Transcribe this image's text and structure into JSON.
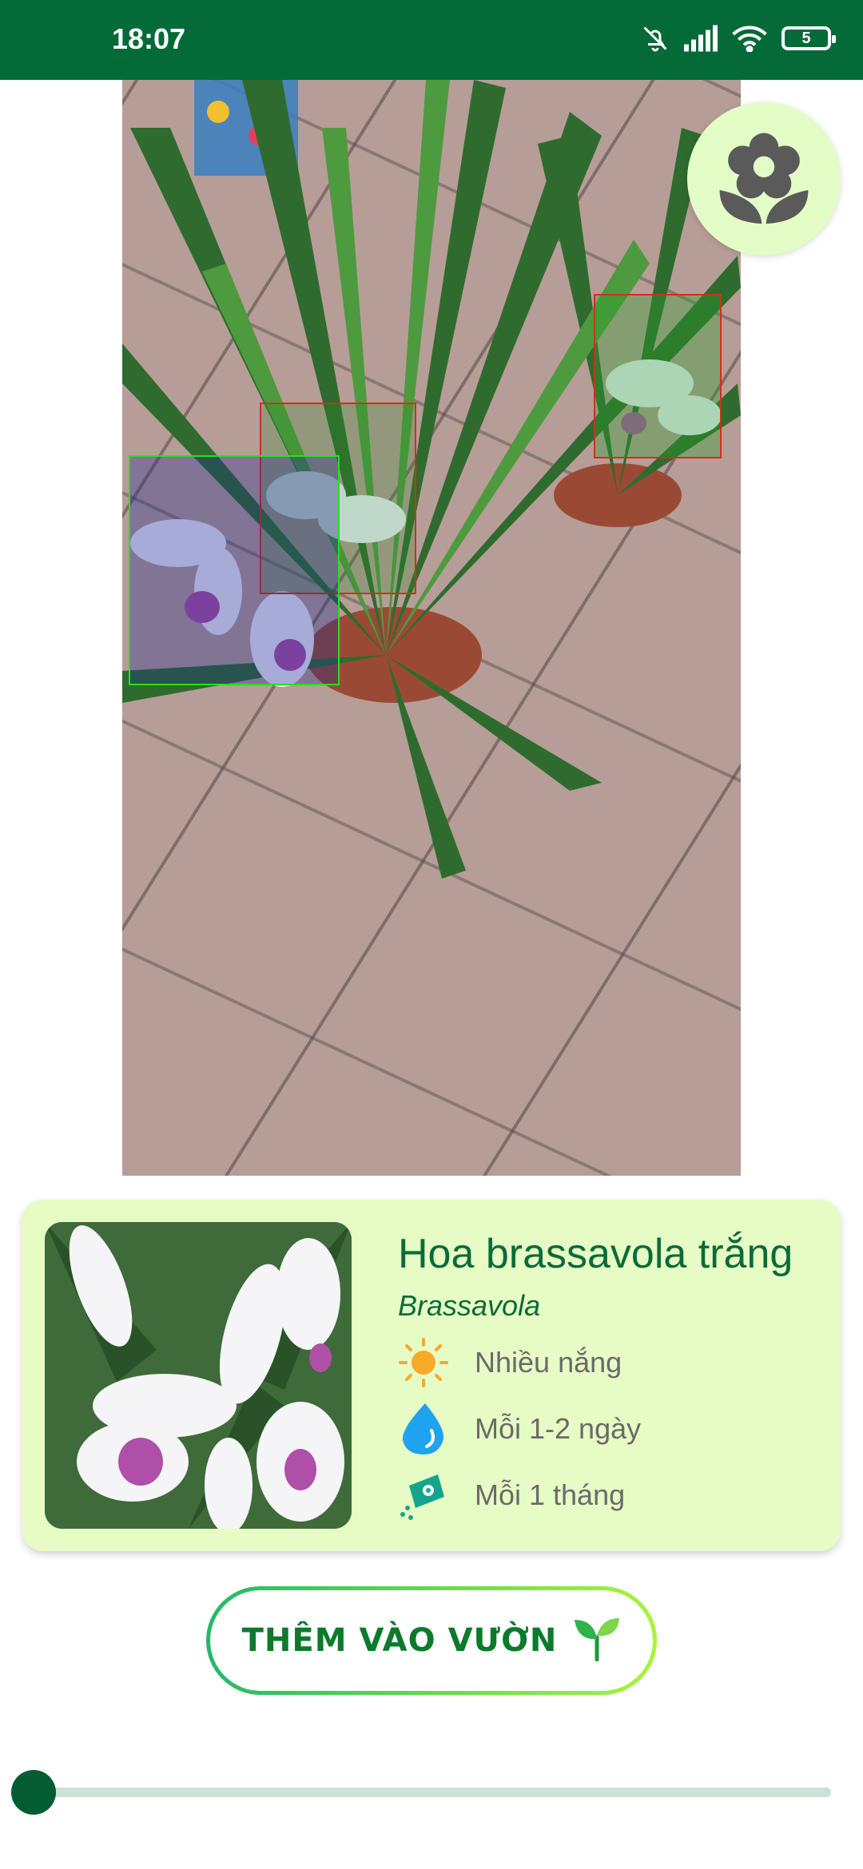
{
  "status_bar": {
    "time": "18:07",
    "battery_level": "5",
    "icons": [
      "bell-off-icon",
      "signal-icon",
      "wifi-icon",
      "battery-icon"
    ]
  },
  "camera": {
    "detections": 3,
    "box_colors": [
      "#d0301a",
      "#d0301a",
      "#27e01b"
    ]
  },
  "fab": {
    "icon": "flower-icon",
    "color": "#5a5a5a"
  },
  "plant_card": {
    "name": "Hoa brassavola trắng",
    "scientific_name": "Brassavola",
    "light": "Nhiều nắng",
    "watering": "Mỗi 1-2 ngày",
    "fertilizing": "Mỗi 1 tháng",
    "icons": {
      "light": "sun-icon",
      "watering": "water-drop-icon",
      "fertilizing": "fertilizer-icon"
    }
  },
  "add_button": {
    "label": "THÊM VÀO VƯỜN",
    "icon": "sprout-icon"
  },
  "slider": {
    "value": 0
  },
  "colors": {
    "primary": "#046a38",
    "card_bg": "#e6fcc4",
    "accent_green": "#0b6b3a"
  }
}
